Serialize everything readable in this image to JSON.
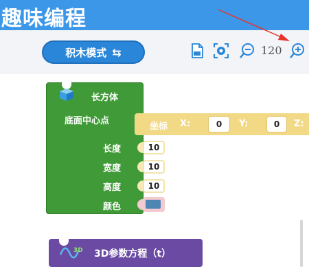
{
  "app": {
    "title": "趣味编程"
  },
  "toolbar": {
    "mode_label": "积木模式",
    "mode_swap_symbol": "⇆",
    "zoom_value": "120",
    "icons": [
      "export-file-icon",
      "screenshot-icon",
      "zoom-out-icon",
      "zoom-in-icon"
    ]
  },
  "blocks": {
    "cuboid": {
      "title": "长方体",
      "base_center_label": "底面中心点",
      "length_label": "长度",
      "length_value": "10",
      "width_label": "宽度",
      "width_value": "10",
      "height_label": "高度",
      "height_value": "10",
      "color_label": "颜色",
      "color_value": "#4b86b4"
    },
    "coordinate": {
      "label": "坐标",
      "x_label": "X:",
      "x_value": "0",
      "y_label": "Y:",
      "y_value": "0",
      "z_label": "Z:"
    },
    "parametric": {
      "icon_text": "3D",
      "label": "3D参数方程（t）"
    }
  },
  "colors": {
    "header": "#3d97e9",
    "mode_button": "#2a86d8",
    "green_block": "#3f9a37",
    "yellow_block": "#f2d986",
    "purple_block": "#6a4aa2",
    "annotation_arrow": "#e8322a"
  }
}
